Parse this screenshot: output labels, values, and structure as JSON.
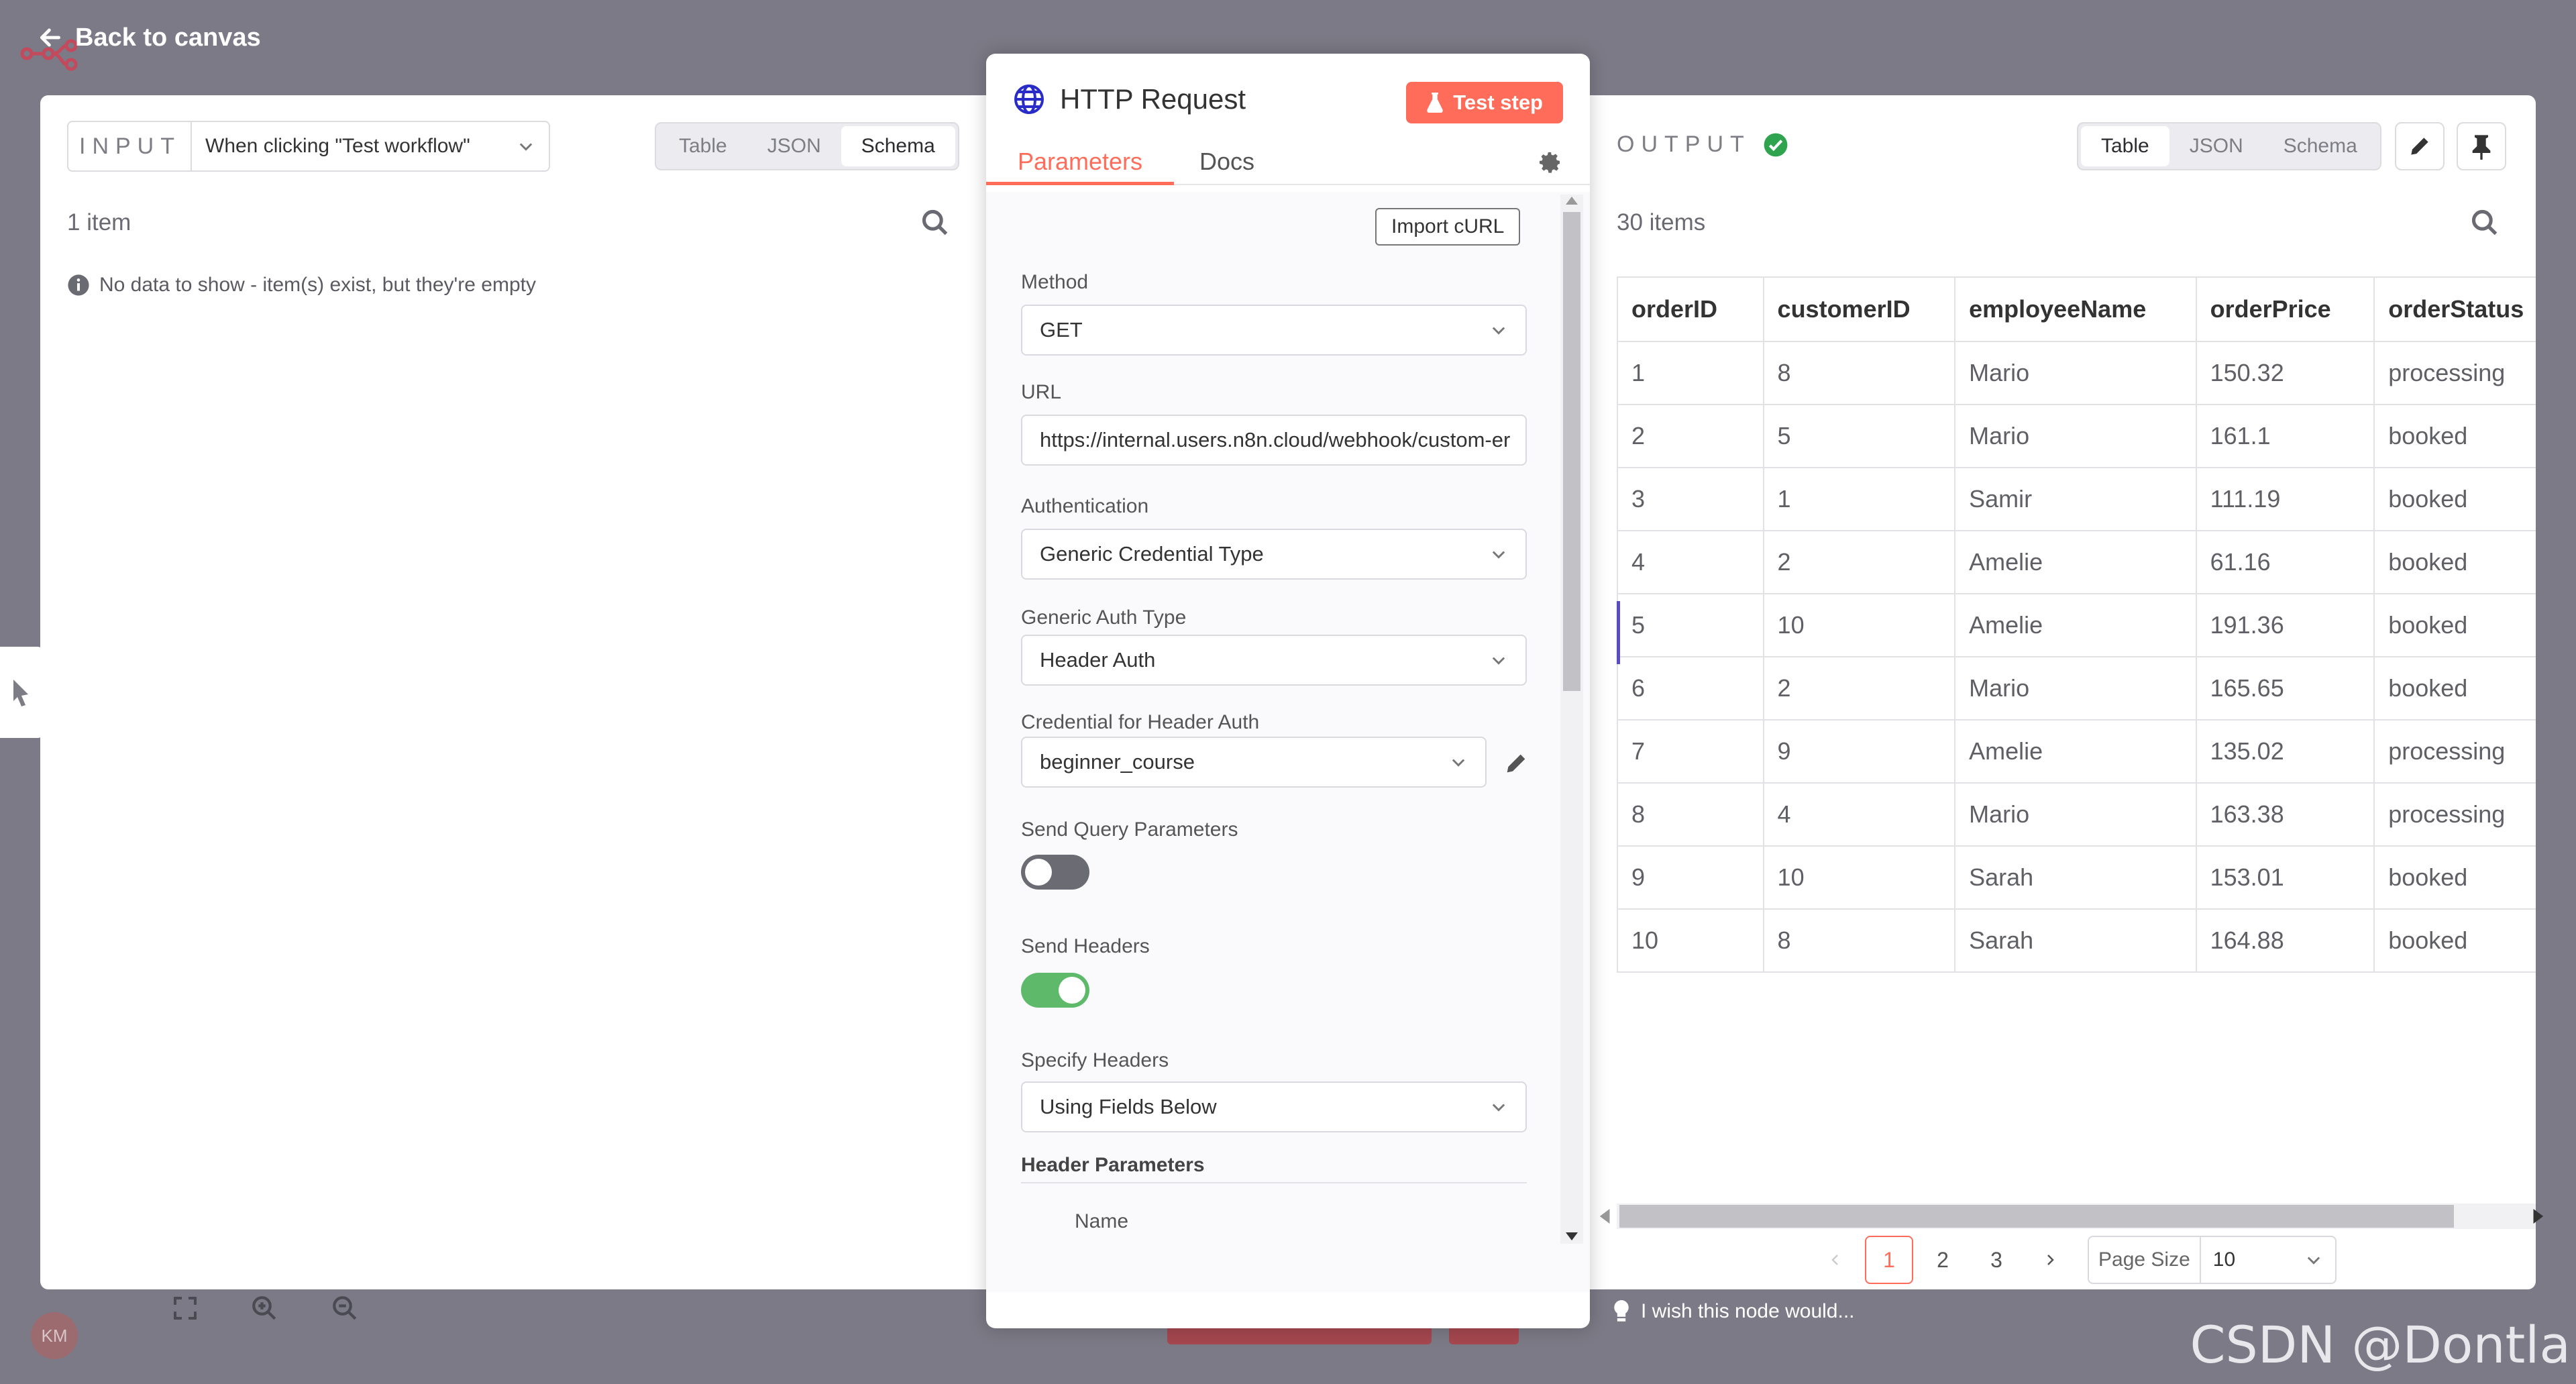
{
  "topbar": {
    "back_label": "Back to canvas"
  },
  "input": {
    "heading": "INPUT",
    "trigger_select": "When clicking \"Test workflow\"",
    "view_tabs": [
      "Table",
      "JSON",
      "Schema"
    ],
    "active_tab": "Schema",
    "item_count": "1 item",
    "empty_message": "No data to show - item(s) exist, but they're empty"
  },
  "node": {
    "title": "HTTP Request",
    "test_button": "Test step",
    "tabs": [
      "Parameters",
      "Docs"
    ],
    "active_tab": "Parameters",
    "import_curl": "Import cURL",
    "method_label": "Method",
    "method_value": "GET",
    "url_label": "URL",
    "url_value": "https://internal.users.n8n.cloud/webhook/custom-er",
    "auth_label": "Authentication",
    "auth_value": "Generic Credential Type",
    "generic_auth_label": "Generic Auth Type",
    "generic_auth_value": "Header Auth",
    "credential_label": "Credential for Header Auth",
    "credential_value": "beginner_course",
    "send_query_label": "Send Query Parameters",
    "send_query_on": false,
    "send_headers_label": "Send Headers",
    "send_headers_on": true,
    "specify_headers_label": "Specify Headers",
    "specify_headers_value": "Using Fields Below",
    "header_params_label": "Header Parameters",
    "name_label": "Name"
  },
  "output": {
    "heading": "OUTPUT",
    "view_tabs": [
      "Table",
      "JSON",
      "Schema"
    ],
    "active_tab": "Table",
    "item_count": "30 items",
    "columns": [
      "orderID",
      "customerID",
      "employeeName",
      "orderPrice",
      "orderStatus"
    ],
    "rows": [
      [
        "1",
        "8",
        "Mario",
        "150.32",
        "processing"
      ],
      [
        "2",
        "5",
        "Mario",
        "161.1",
        "booked"
      ],
      [
        "3",
        "1",
        "Samir",
        "111.19",
        "booked"
      ],
      [
        "4",
        "2",
        "Amelie",
        "61.16",
        "booked"
      ],
      [
        "5",
        "10",
        "Amelie",
        "191.36",
        "booked"
      ],
      [
        "6",
        "2",
        "Mario",
        "165.65",
        "booked"
      ],
      [
        "7",
        "9",
        "Amelie",
        "135.02",
        "processing"
      ],
      [
        "8",
        "4",
        "Mario",
        "163.38",
        "processing"
      ],
      [
        "9",
        "10",
        "Sarah",
        "153.01",
        "booked"
      ],
      [
        "10",
        "8",
        "Sarah",
        "164.88",
        "booked"
      ]
    ],
    "pages": [
      "1",
      "2",
      "3"
    ],
    "active_page": "1",
    "page_size_label": "Page Size",
    "page_size_value": "10"
  },
  "feedback": {
    "text": "I wish this node would..."
  },
  "user": {
    "initials": "KM"
  },
  "watermark": "CSDN @Dontla",
  "colors": {
    "accent": "#ff6d5a",
    "toggle_on": "#5eba6a",
    "toggle_off": "#6b6b73",
    "success": "#2fa34e"
  }
}
